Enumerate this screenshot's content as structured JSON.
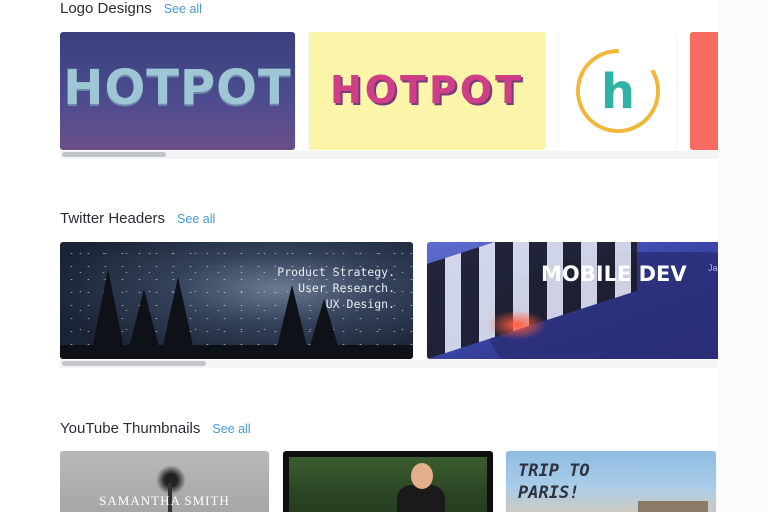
{
  "sections": {
    "logo": {
      "title": "Logo Designs",
      "see_all": "See all",
      "card1": "HOTPOT",
      "card2": "HOTPOT",
      "card3": "h",
      "scroll_progress": 0.2
    },
    "twitter": {
      "title": "Twitter Headers",
      "see_all": "See all",
      "card1": {
        "line1": "Product Strategy.",
        "line2": "User Research.",
        "line3": "UX Design."
      },
      "card2": {
        "title": "MOBILE DEV",
        "extra": "Ja"
      },
      "scroll_progress": 0.25
    },
    "youtube": {
      "title": "YouTube Thumbnails",
      "see_all": "See all",
      "card1": {
        "name": "SAMANTHA SMITH"
      },
      "card3": {
        "line1": "TRIP TO",
        "line2": "PARIS!"
      }
    }
  },
  "colors": {
    "link": "#4a98d8",
    "logo1_bg": "#3f437f",
    "logo2_bg": "#faf5a9",
    "logo4_bg": "#f86b62",
    "h_ring": "#f0b73a",
    "h_letter": "#2fb3a6"
  },
  "icons": [
    "palm-tree-icon",
    "scrollbar-thumb"
  ]
}
